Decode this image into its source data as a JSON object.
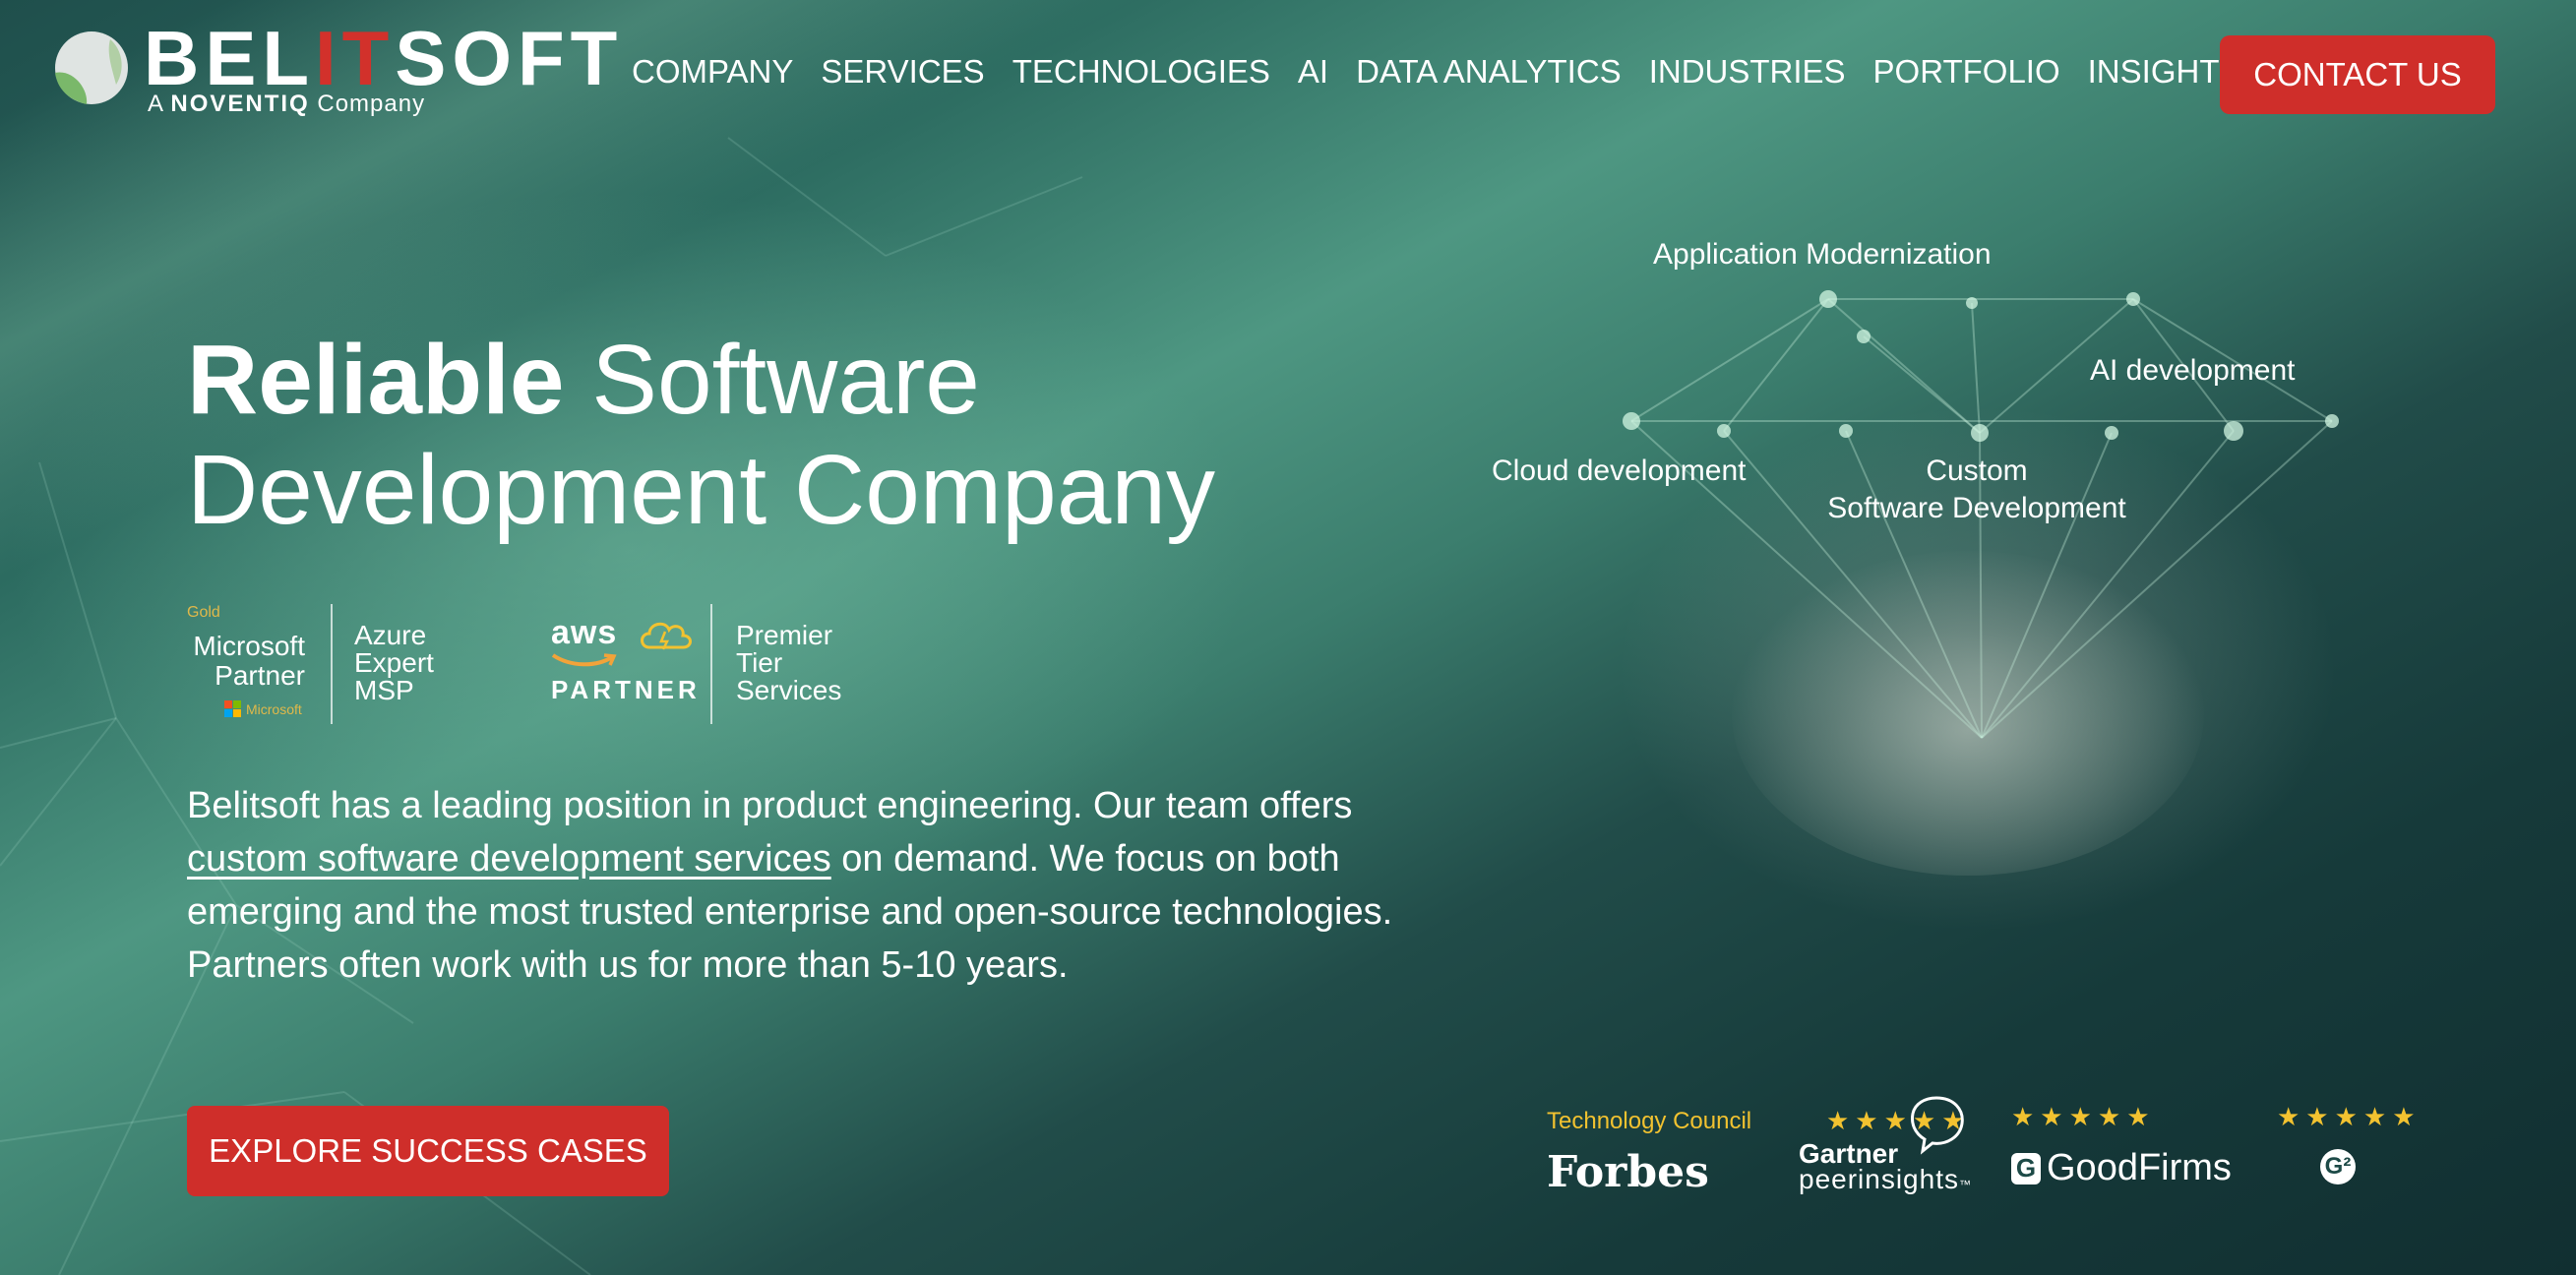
{
  "header": {
    "logo": {
      "brand_prefix": "BEL",
      "brand_accent": "IT",
      "brand_suffix": "SOFT",
      "tagline_prefix": "A",
      "tagline_company": "NOVENTIQ",
      "tagline_suffix": "Company",
      "accent_color": "#d2312b"
    },
    "nav": [
      "COMPANY",
      "SERVICES",
      "TECHNOLOGIES",
      "AI",
      "DATA ANALYTICS",
      "INDUSTRIES",
      "PORTFOLIO",
      "INSIGHTS"
    ],
    "contact_label": "CONTACT US"
  },
  "hero": {
    "title_bold": "Reliable",
    "title_rest_line1": " Software",
    "title_line2": "Development Company",
    "badges": {
      "microsoft": {
        "level": "Gold",
        "name_line1": "Microsoft",
        "name_line2": "Partner",
        "brand": "Microsoft",
        "spec_lines": [
          "Azure",
          "Expert",
          "MSP"
        ]
      },
      "aws": {
        "logo": "aws",
        "partner": "PARTNER",
        "spec_lines": [
          "Premier",
          "Tier",
          "Services"
        ]
      }
    },
    "description_before_link": "Belitsoft has a leading position in product engineering. Our team offers ",
    "description_link": "custom software development services",
    "description_after_link": " on demand. We focus on both emerging and the most trusted enterprise and open-source technologies. Partners often work with us for more than 5-10 years.",
    "cta_label": "EXPLORE SUCCESS CASES"
  },
  "diagram": {
    "services": {
      "modernization": "Application Modernization",
      "ai": "AI development",
      "cloud": "Cloud development",
      "custom_line1": "Custom",
      "custom_line2": "Software Development"
    }
  },
  "ratings": {
    "forbes": {
      "council": "Technology Council",
      "logo": "Forbes"
    },
    "gartner": {
      "stars": "★★★★★",
      "line1": "Gartner",
      "line2": "peerinsights",
      "tm": "™"
    },
    "goodfirms": {
      "stars": "★★★★★",
      "logo": "GoodFirms"
    },
    "g2": {
      "stars": "★★★★★",
      "logo": "G²"
    },
    "star_color": "#f2c230"
  },
  "colors": {
    "cta_red": "#cf2e2a",
    "background": "#1f4f4c"
  }
}
